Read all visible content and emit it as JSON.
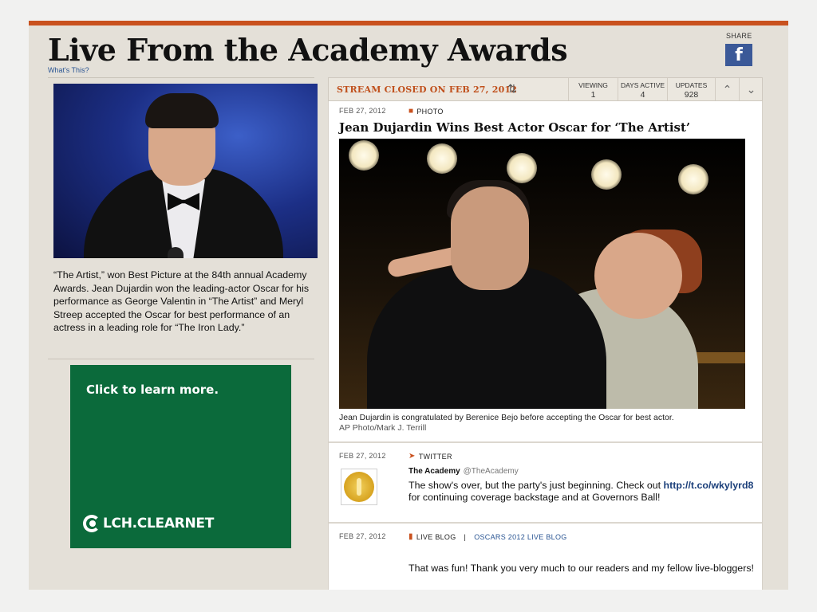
{
  "header": {
    "title": "Live From the Academy Awards",
    "whats_this": "What's This?",
    "share_label": "SHARE",
    "facebook_icon": "f"
  },
  "left": {
    "hero_caption": "“The Artist,” won Best Picture at the 84th annual Academy Awards. Jean Dujardin won the leading-actor Oscar for his performance as George Valentin in “The Artist” and Meryl Streep accepted the Oscar for best performance of an actress in a leading role for “The Iron Lady.”",
    "ad": {
      "cta": "Click to learn more.",
      "brand": "LCH.CLEARNET",
      "background": "#0b6a3b"
    }
  },
  "stream": {
    "status": "STREAM CLOSED ON FEB 27, 2012",
    "refresh_icon": "⇅",
    "stats": [
      {
        "label": "VIEWING",
        "value": "1"
      },
      {
        "label": "DAYS ACTIVE",
        "value": "4"
      },
      {
        "label": "UPDATES",
        "value": "928"
      }
    ],
    "nav_up_icon": "⌃",
    "nav_down_icon": "⌄",
    "accent": "#c9511e"
  },
  "posts": {
    "photo": {
      "date": "FEB 27, 2012",
      "type": "PHOTO",
      "headline": "Jean Dujardin Wins Best Actor Oscar for ‘The Artist’",
      "caption": "Jean Dujardin is congratulated by Berenice Bejo before accepting the Oscar for best actor.",
      "credit": "AP Photo/Mark J. Terrill"
    },
    "tweet": {
      "date": "FEB 27, 2012",
      "type": "TWITTER",
      "author": "The Academy",
      "handle": "@TheAcademy",
      "text_before": "The show's over, but the party's just beginning. Check out",
      "link": "http://t.co/wkylyrd8",
      "text_after": "for continuing coverage backstage and at Governors Ball!"
    },
    "blog": {
      "date": "FEB 27, 2012",
      "type": "LIVE BLOG",
      "separator": "|",
      "blog_name": "OSCARS 2012 LIVE BLOG",
      "text": "That was fun! Thank you very much to our readers and my fellow live-bloggers!"
    }
  }
}
